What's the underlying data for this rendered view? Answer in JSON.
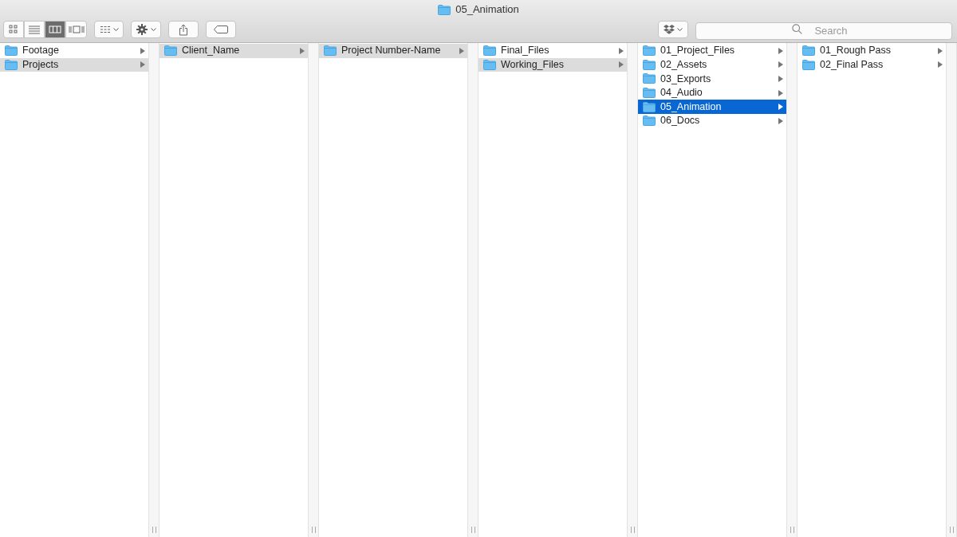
{
  "window": {
    "title": "05_Animation"
  },
  "view_modes": [
    {
      "selected": false
    },
    {
      "selected": false
    },
    {
      "selected": true
    },
    {
      "selected": false
    }
  ],
  "search": {
    "placeholder": "Search"
  },
  "columns": [
    {
      "active": false,
      "items": [
        {
          "name": "Footage",
          "selected": false
        },
        {
          "name": "Projects",
          "selected": true
        }
      ]
    },
    {
      "active": false,
      "items": [
        {
          "name": "Client_Name",
          "selected": true
        }
      ]
    },
    {
      "active": false,
      "items": [
        {
          "name": "Project Number-Name",
          "selected": true
        }
      ]
    },
    {
      "active": false,
      "items": [
        {
          "name": "Final_Files",
          "selected": false
        },
        {
          "name": "Working_Files",
          "selected": true
        }
      ]
    },
    {
      "active": true,
      "items": [
        {
          "name": "01_Project_Files",
          "selected": false
        },
        {
          "name": "02_Assets",
          "selected": false
        },
        {
          "name": "03_Exports",
          "selected": false
        },
        {
          "name": "04_Audio",
          "selected": false
        },
        {
          "name": "05_Animation",
          "selected": true
        },
        {
          "name": "06_Docs",
          "selected": false
        }
      ]
    },
    {
      "items": [
        {
          "name": "01_Rough Pass",
          "selected": false
        },
        {
          "name": "02_Final Pass",
          "selected": false
        }
      ]
    }
  ]
}
